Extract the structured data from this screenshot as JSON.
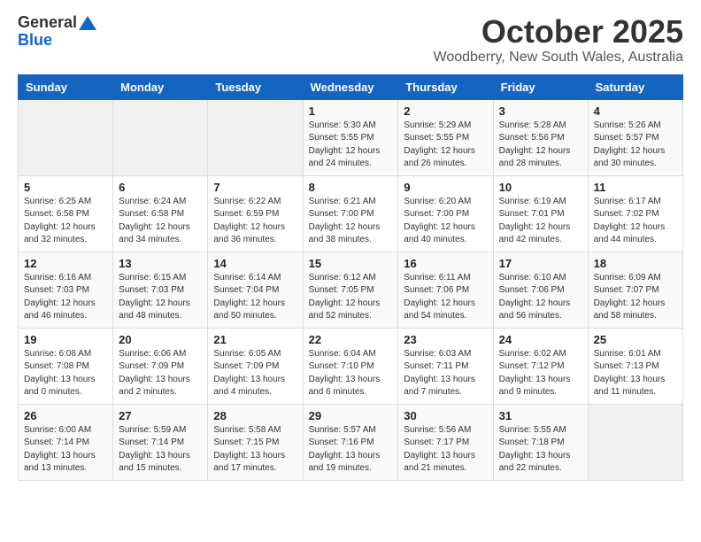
{
  "header": {
    "logo_general": "General",
    "logo_blue": "Blue",
    "month_title": "October 2025",
    "location": "Woodberry, New South Wales, Australia"
  },
  "weekdays": [
    "Sunday",
    "Monday",
    "Tuesday",
    "Wednesday",
    "Thursday",
    "Friday",
    "Saturday"
  ],
  "weeks": [
    [
      {
        "day": "",
        "info": ""
      },
      {
        "day": "",
        "info": ""
      },
      {
        "day": "",
        "info": ""
      },
      {
        "day": "1",
        "info": "Sunrise: 5:30 AM\nSunset: 5:55 PM\nDaylight: 12 hours\nand 24 minutes."
      },
      {
        "day": "2",
        "info": "Sunrise: 5:29 AM\nSunset: 5:55 PM\nDaylight: 12 hours\nand 26 minutes."
      },
      {
        "day": "3",
        "info": "Sunrise: 5:28 AM\nSunset: 5:56 PM\nDaylight: 12 hours\nand 28 minutes."
      },
      {
        "day": "4",
        "info": "Sunrise: 5:26 AM\nSunset: 5:57 PM\nDaylight: 12 hours\nand 30 minutes."
      }
    ],
    [
      {
        "day": "5",
        "info": "Sunrise: 6:25 AM\nSunset: 6:58 PM\nDaylight: 12 hours\nand 32 minutes."
      },
      {
        "day": "6",
        "info": "Sunrise: 6:24 AM\nSunset: 6:58 PM\nDaylight: 12 hours\nand 34 minutes."
      },
      {
        "day": "7",
        "info": "Sunrise: 6:22 AM\nSunset: 6:59 PM\nDaylight: 12 hours\nand 36 minutes."
      },
      {
        "day": "8",
        "info": "Sunrise: 6:21 AM\nSunset: 7:00 PM\nDaylight: 12 hours\nand 38 minutes."
      },
      {
        "day": "9",
        "info": "Sunrise: 6:20 AM\nSunset: 7:00 PM\nDaylight: 12 hours\nand 40 minutes."
      },
      {
        "day": "10",
        "info": "Sunrise: 6:19 AM\nSunset: 7:01 PM\nDaylight: 12 hours\nand 42 minutes."
      },
      {
        "day": "11",
        "info": "Sunrise: 6:17 AM\nSunset: 7:02 PM\nDaylight: 12 hours\nand 44 minutes."
      }
    ],
    [
      {
        "day": "12",
        "info": "Sunrise: 6:16 AM\nSunset: 7:03 PM\nDaylight: 12 hours\nand 46 minutes."
      },
      {
        "day": "13",
        "info": "Sunrise: 6:15 AM\nSunset: 7:03 PM\nDaylight: 12 hours\nand 48 minutes."
      },
      {
        "day": "14",
        "info": "Sunrise: 6:14 AM\nSunset: 7:04 PM\nDaylight: 12 hours\nand 50 minutes."
      },
      {
        "day": "15",
        "info": "Sunrise: 6:12 AM\nSunset: 7:05 PM\nDaylight: 12 hours\nand 52 minutes."
      },
      {
        "day": "16",
        "info": "Sunrise: 6:11 AM\nSunset: 7:06 PM\nDaylight: 12 hours\nand 54 minutes."
      },
      {
        "day": "17",
        "info": "Sunrise: 6:10 AM\nSunset: 7:06 PM\nDaylight: 12 hours\nand 56 minutes."
      },
      {
        "day": "18",
        "info": "Sunrise: 6:09 AM\nSunset: 7:07 PM\nDaylight: 12 hours\nand 58 minutes."
      }
    ],
    [
      {
        "day": "19",
        "info": "Sunrise: 6:08 AM\nSunset: 7:08 PM\nDaylight: 13 hours\nand 0 minutes."
      },
      {
        "day": "20",
        "info": "Sunrise: 6:06 AM\nSunset: 7:09 PM\nDaylight: 13 hours\nand 2 minutes."
      },
      {
        "day": "21",
        "info": "Sunrise: 6:05 AM\nSunset: 7:09 PM\nDaylight: 13 hours\nand 4 minutes."
      },
      {
        "day": "22",
        "info": "Sunrise: 6:04 AM\nSunset: 7:10 PM\nDaylight: 13 hours\nand 6 minutes."
      },
      {
        "day": "23",
        "info": "Sunrise: 6:03 AM\nSunset: 7:11 PM\nDaylight: 13 hours\nand 7 minutes."
      },
      {
        "day": "24",
        "info": "Sunrise: 6:02 AM\nSunset: 7:12 PM\nDaylight: 13 hours\nand 9 minutes."
      },
      {
        "day": "25",
        "info": "Sunrise: 6:01 AM\nSunset: 7:13 PM\nDaylight: 13 hours\nand 11 minutes."
      }
    ],
    [
      {
        "day": "26",
        "info": "Sunrise: 6:00 AM\nSunset: 7:14 PM\nDaylight: 13 hours\nand 13 minutes."
      },
      {
        "day": "27",
        "info": "Sunrise: 5:59 AM\nSunset: 7:14 PM\nDaylight: 13 hours\nand 15 minutes."
      },
      {
        "day": "28",
        "info": "Sunrise: 5:58 AM\nSunset: 7:15 PM\nDaylight: 13 hours\nand 17 minutes."
      },
      {
        "day": "29",
        "info": "Sunrise: 5:57 AM\nSunset: 7:16 PM\nDaylight: 13 hours\nand 19 minutes."
      },
      {
        "day": "30",
        "info": "Sunrise: 5:56 AM\nSunset: 7:17 PM\nDaylight: 13 hours\nand 21 minutes."
      },
      {
        "day": "31",
        "info": "Sunrise: 5:55 AM\nSunset: 7:18 PM\nDaylight: 13 hours\nand 22 minutes."
      },
      {
        "day": "",
        "info": ""
      }
    ]
  ]
}
